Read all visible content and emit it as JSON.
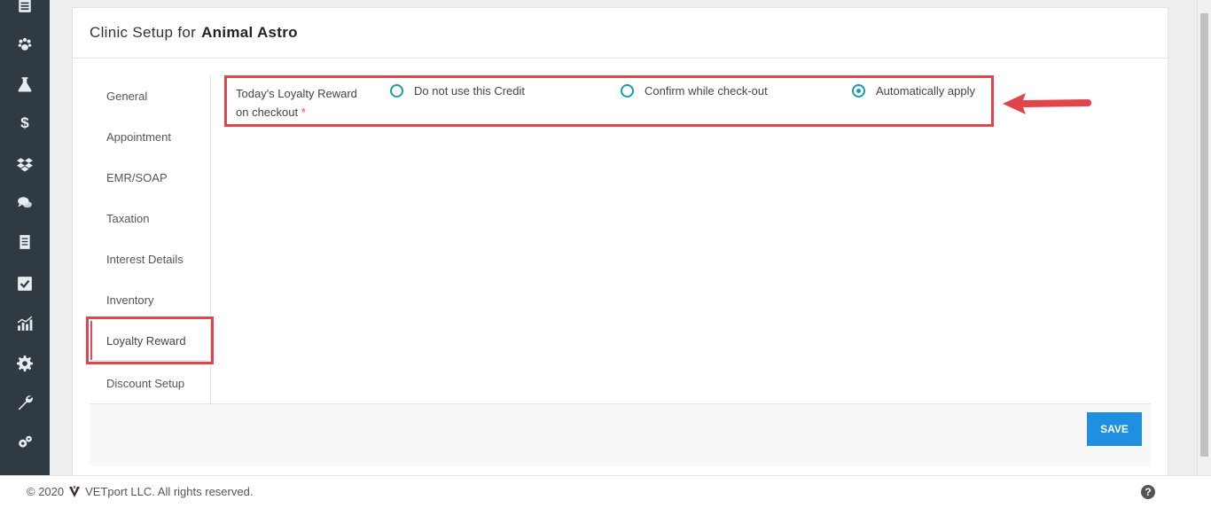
{
  "header": {
    "title_prefix": "Clinic Setup for",
    "clinic_name": "Animal Astro"
  },
  "sidebar": {
    "icons": [
      "calendar-icon",
      "paw-icon",
      "flask-icon",
      "dollar-icon",
      "dropbox-icon",
      "chat-icon",
      "document-icon",
      "checklist-icon",
      "chart-icon",
      "gear-icon",
      "wrench-icon",
      "gears-icon"
    ],
    "dollar_glyph": "$"
  },
  "tabs": [
    {
      "label": "General"
    },
    {
      "label": "Appointment"
    },
    {
      "label": "EMR/SOAP"
    },
    {
      "label": "Taxation"
    },
    {
      "label": "Interest Details"
    },
    {
      "label": "Inventory"
    },
    {
      "label": "Loyalty Reward",
      "active": true
    },
    {
      "label": "Discount Setup"
    }
  ],
  "loyalty": {
    "field_label": "Today's Loyalty Reward on checkout",
    "required_mark": "*",
    "options": [
      {
        "label": "Do not use this Credit",
        "checked": false
      },
      {
        "label": "Confirm while check-out",
        "checked": false
      },
      {
        "label": "Automatically apply",
        "checked": true
      }
    ]
  },
  "actions": {
    "save_label": "SAVE"
  },
  "footer": {
    "copyright_prefix": "© 2020",
    "company": "VETport LLC. All rights reserved.",
    "help_glyph": "?"
  },
  "colors": {
    "sidebar_bg": "#2f3a42",
    "accent_teal": "#1a9ca8",
    "save_blue": "#1f8fe0",
    "highlight_red": "#e0454c"
  }
}
